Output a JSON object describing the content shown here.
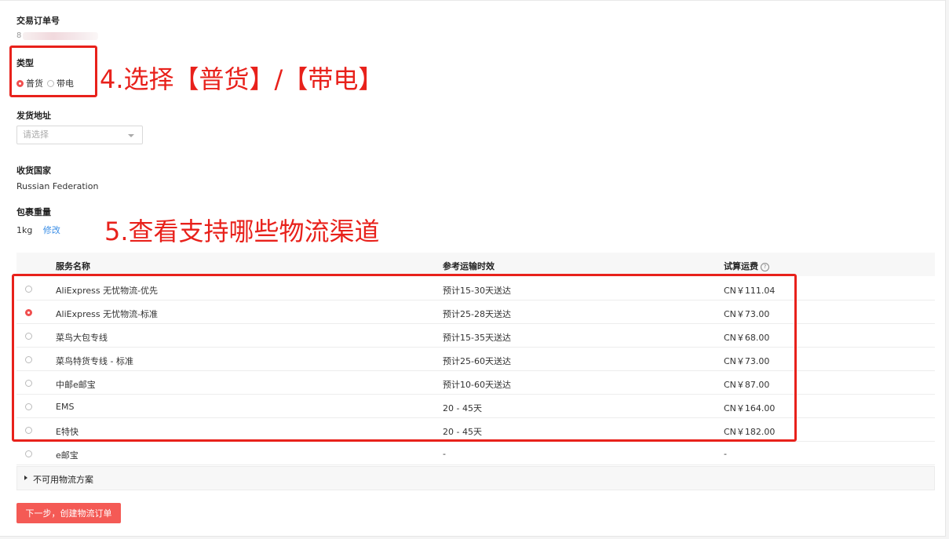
{
  "form": {
    "order_no_label": "交易订单号",
    "order_no_prefix": "8",
    "type_label": "类型",
    "type_options": [
      {
        "label": "普货",
        "selected": true
      },
      {
        "label": "带电",
        "selected": false
      }
    ],
    "ship_address_label": "发货地址",
    "ship_address_placeholder": "请选择",
    "dest_country_label": "收货国家",
    "dest_country_value": "Russian Federation",
    "weight_label": "包裹重量",
    "weight_value": "1kg",
    "weight_edit": "修改"
  },
  "annotations": {
    "step4": "4.选择【普货】/【带电】",
    "step5": "5.查看支持哪些物流渠道",
    "color": "#e8211b"
  },
  "table": {
    "headers": {
      "service": "服务名称",
      "time": "参考运输时效",
      "fee": "试算运费",
      "fee_help_icon": "?"
    },
    "rows": [
      {
        "service": "AliExpress 无忧物流-优先",
        "time": "预计15-30天送达",
        "fee": "CN￥111.04",
        "selected": false
      },
      {
        "service": "AliExpress 无忧物流-标准",
        "time": "预计25-28天送达",
        "fee": "CN￥73.00",
        "selected": true
      },
      {
        "service": "菜鸟大包专线",
        "time": "预计15-35天送达",
        "fee": "CN￥68.00",
        "selected": false
      },
      {
        "service": "菜鸟特货专线 - 标准",
        "time": "预计25-60天送达",
        "fee": "CN￥73.00",
        "selected": false
      },
      {
        "service": "中邮e邮宝",
        "time": "预计10-60天送达",
        "fee": "CN￥87.00",
        "selected": false
      },
      {
        "service": "EMS",
        "time": "20 - 45天",
        "fee": "CN￥164.00",
        "selected": false
      },
      {
        "service": "E特快",
        "time": "20 - 45天",
        "fee": "CN￥182.00",
        "selected": false
      },
      {
        "service": "e邮宝",
        "time": "-",
        "fee": "-",
        "selected": false
      }
    ],
    "unavailable_label": "不可用物流方案"
  },
  "actions": {
    "next_button": "下一步，创建物流订单"
  },
  "colors": {
    "accent": "#f04f4f",
    "button": "#f45a55",
    "link": "#3a8ee6"
  }
}
